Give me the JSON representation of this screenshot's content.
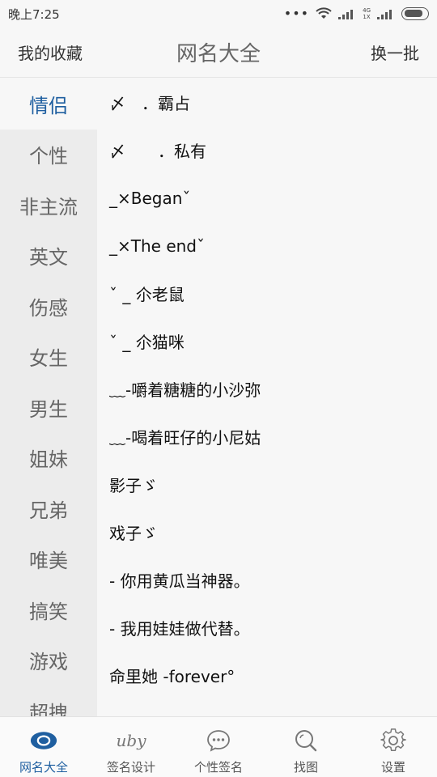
{
  "status_bar": {
    "time": "晚上7:25",
    "network_top": "4G",
    "network_bottom": "1X"
  },
  "header": {
    "left_label": "我的收藏",
    "title": "网名大全",
    "right_label": "换一批"
  },
  "sidebar": {
    "items": [
      {
        "label": "情侣"
      },
      {
        "label": "个性"
      },
      {
        "label": "非主流"
      },
      {
        "label": "英文"
      },
      {
        "label": "伤感"
      },
      {
        "label": "女生"
      },
      {
        "label": "男生"
      },
      {
        "label": "姐妹"
      },
      {
        "label": "兄弟"
      },
      {
        "label": "唯美"
      },
      {
        "label": "搞笑"
      },
      {
        "label": "游戏"
      },
      {
        "label": "超拽"
      }
    ],
    "active_index": 0
  },
  "names": [
    "〆　．霸占",
    "〆　　．私有",
    "_×Beganˇ",
    "_×The endˇ",
    "ˇ _ 尒老鼠",
    "ˇ _ 尒猫咪",
    "﹏-嚼着糖糖的小沙弥",
    "﹏-喝着旺仔的小尼姑",
    "影子ゞ",
    "戏子ゞ",
    "- 你用黄瓜当神器。",
    "- 我用娃娃做代替。",
    "命里她 -forever°"
  ],
  "bottom_nav": {
    "items": [
      {
        "label": "网名大全",
        "icon": "eye-icon"
      },
      {
        "label": "签名设计",
        "icon": "signature-icon",
        "glyph": "uby"
      },
      {
        "label": "个性签名",
        "icon": "chat-bubble-icon"
      },
      {
        "label": "找图",
        "icon": "search-icon"
      },
      {
        "label": "设置",
        "icon": "gear-icon"
      }
    ]
  },
  "colors": {
    "accent": "#1f5fa0",
    "sidebar_bg": "#ececec",
    "page_bg": "#f7f7f7"
  }
}
